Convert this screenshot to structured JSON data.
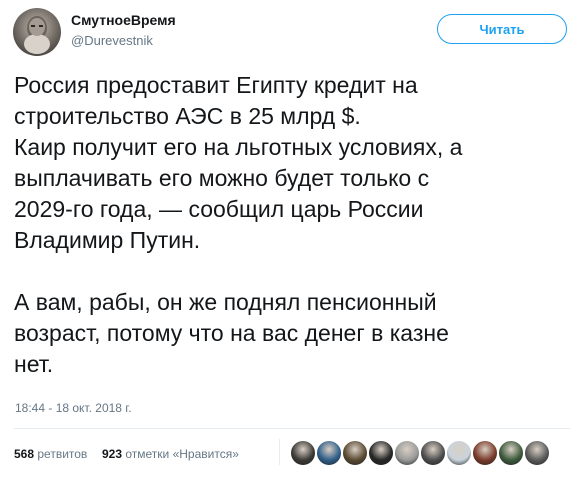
{
  "author": {
    "display_name": "СмутноеВремя",
    "handle": "@Durevestnik"
  },
  "follow_button": {
    "label": "Читать"
  },
  "tweet": {
    "paragraph1": [
      "Россия предоставит Египту кредит на",
      "строительство АЭС в 25 млрд $.",
      "Каир получит его на льготных условиях, а",
      "выплачивать его можно будет только с",
      "2029-го года, — сообщил царь России",
      "Владимир Путин."
    ],
    "paragraph2": [
      "А вам, рабы, он же поднял пенсионный",
      "возраст, потому что на вас денег в казне",
      "нет."
    ],
    "timestamp": "18:44 - 18 окт. 2018 г."
  },
  "stats": {
    "retweets_count": "568",
    "retweets_label": "ретвитов",
    "likes_count": "923",
    "likes_label": "отметки «Нравится»"
  },
  "likers": [
    {
      "name": "liker-avatar-1",
      "color": "#3b3a36"
    },
    {
      "name": "liker-avatar-2",
      "color": "#2f5f8a"
    },
    {
      "name": "liker-avatar-3",
      "color": "#5a4a32"
    },
    {
      "name": "liker-avatar-4",
      "color": "#262626"
    },
    {
      "name": "liker-avatar-5",
      "color": "#9a9a9a"
    },
    {
      "name": "liker-avatar-6",
      "color": "#4e4e4e"
    },
    {
      "name": "liker-avatar-7",
      "color": "#c9d3dc"
    },
    {
      "name": "liker-avatar-8",
      "color": "#7a3b2a"
    },
    {
      "name": "liker-avatar-9",
      "color": "#3c5a3c"
    },
    {
      "name": "liker-avatar-10",
      "color": "#5b5b5b"
    }
  ],
  "colors": {
    "accent": "#1da1f2",
    "text": "#14171a",
    "secondary_text": "#657786",
    "divider": "#e6ecf0"
  }
}
